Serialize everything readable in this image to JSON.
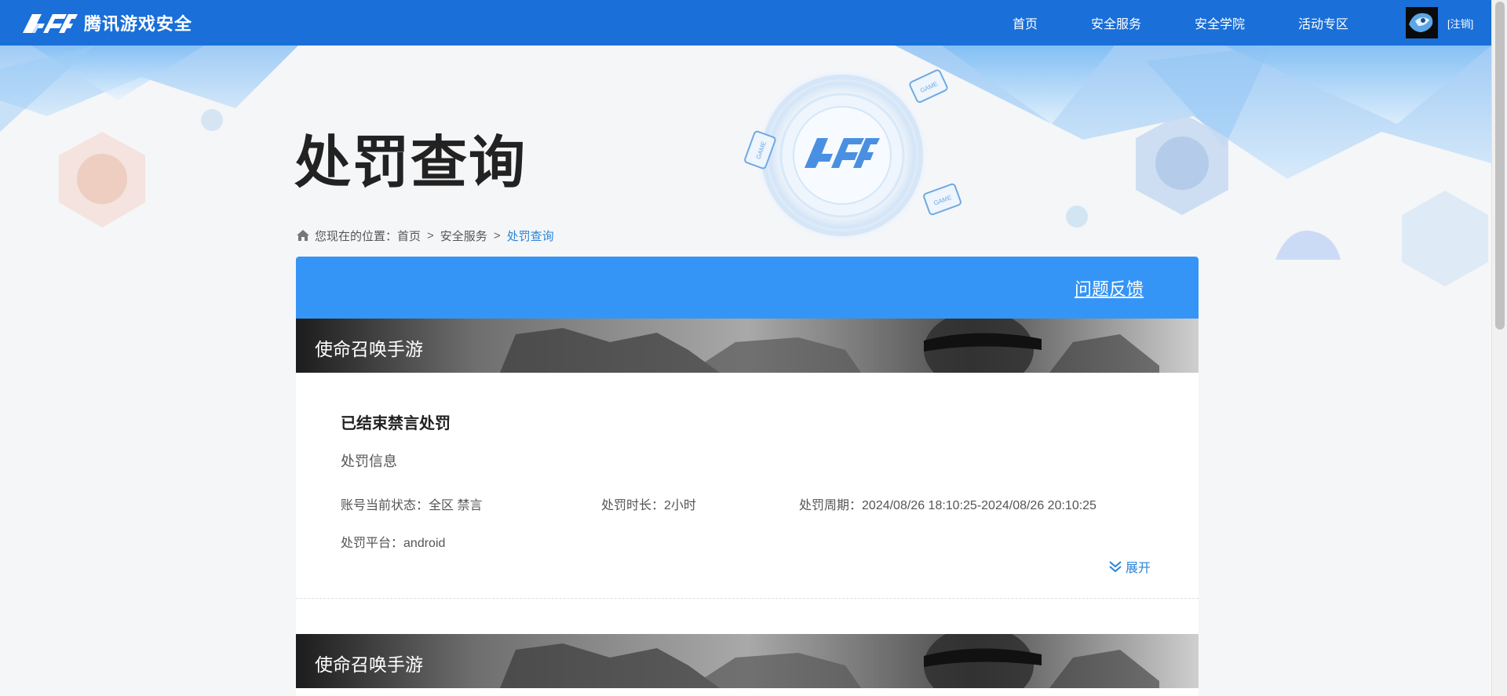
{
  "header": {
    "brand_text": "腾讯游戏安全",
    "nav": [
      "首页",
      "安全服务",
      "安全学院",
      "活动专区"
    ],
    "logout": "[注销]"
  },
  "hero": {
    "title": "处罚查询",
    "badge_labels": [
      "GAME",
      "GAME",
      "GAME"
    ]
  },
  "breadcrumb": {
    "prefix": "您现在的位置：",
    "items": [
      "首页",
      "安全服务",
      "处罚查询"
    ],
    "separator": ">"
  },
  "panel": {
    "feedback": "问题反馈",
    "sections": [
      {
        "game": "使命召唤手游",
        "record": {
          "title": "已结束禁言处罚",
          "subtitle": "处罚信息",
          "status_label": "账号当前状态：",
          "status_value": "全区 禁言",
          "duration_label": "处罚时长：",
          "duration_value": "2小时",
          "period_label": "处罚周期：",
          "period_value": "2024/08/26 18:10:25-2024/08/26 20:10:25",
          "platform_label": "处罚平台：",
          "platform_value": "android",
          "expand": "展开"
        }
      },
      {
        "game": "使命召唤手游"
      }
    ]
  },
  "colors": {
    "nav_bg": "#1a6fd8",
    "panel_head": "#3595f6",
    "link": "#2b84d6"
  }
}
